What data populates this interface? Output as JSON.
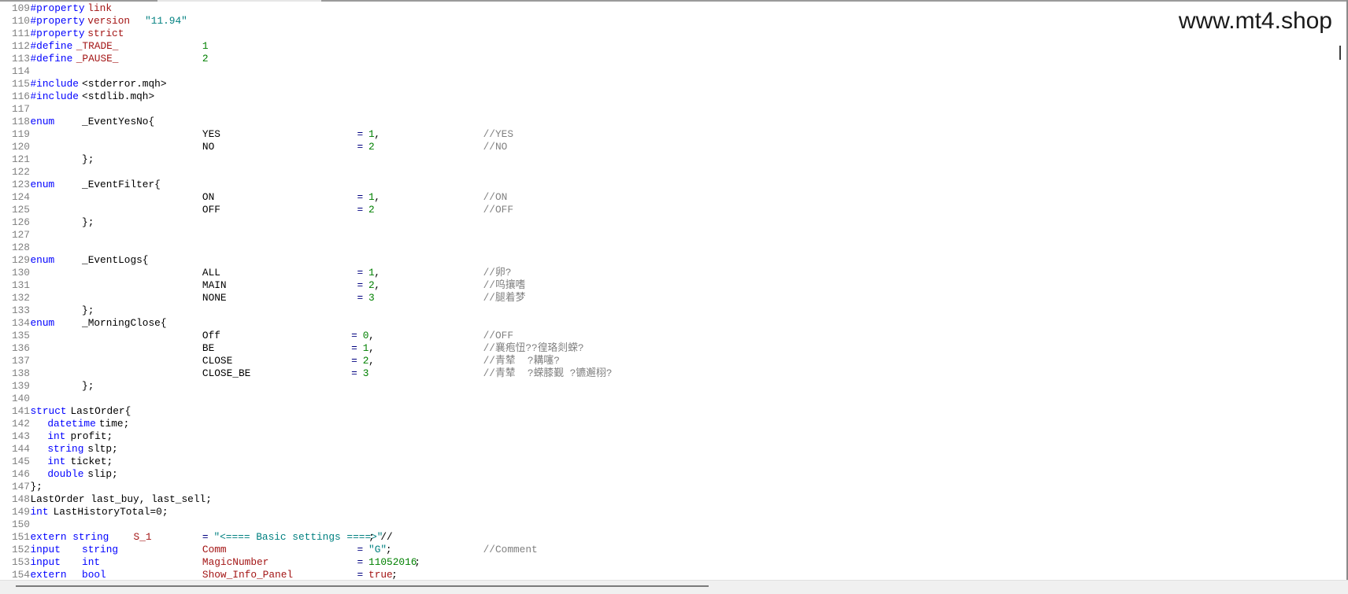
{
  "watermark": "www.mt4.shop",
  "colors": {
    "line_number": "#808080",
    "keyword": "#0000ff",
    "identifier_red": "#a31515",
    "string": "#008080",
    "number": "#008000",
    "comment": "#808080",
    "text": "#000000"
  },
  "lines": [
    {
      "num": "109",
      "tokens": [
        {
          "col": 0,
          "c": "kw",
          "t": "#property"
        },
        {
          "col": 10,
          "c": "red",
          "t": "link"
        }
      ]
    },
    {
      "num": "110",
      "tokens": [
        {
          "col": 0,
          "c": "kw",
          "t": "#property"
        },
        {
          "col": 10,
          "c": "red",
          "t": "version"
        },
        {
          "col": 20,
          "c": "str",
          "t": "\"11.94\""
        }
      ]
    },
    {
      "num": "111",
      "tokens": [
        {
          "col": 0,
          "c": "kw",
          "t": "#property"
        },
        {
          "col": 10,
          "c": "red",
          "t": "strict"
        }
      ]
    },
    {
      "num": "112",
      "tokens": [
        {
          "col": 0,
          "c": "kw",
          "t": "#define"
        },
        {
          "col": 8,
          "c": "red",
          "t": "_TRADE_"
        },
        {
          "col": 30,
          "c": "num",
          "t": "1"
        }
      ]
    },
    {
      "num": "113",
      "tokens": [
        {
          "col": 0,
          "c": "kw",
          "t": "#define"
        },
        {
          "col": 8,
          "c": "red",
          "t": "_PAUSE_"
        },
        {
          "col": 30,
          "c": "num",
          "t": "2"
        }
      ]
    },
    {
      "num": "114",
      "tokens": []
    },
    {
      "num": "115",
      "tokens": [
        {
          "col": 0,
          "c": "kw",
          "t": "#include"
        },
        {
          "col": 9,
          "c": "text",
          "t": "<stderror.mqh>"
        }
      ]
    },
    {
      "num": "116",
      "tokens": [
        {
          "col": 0,
          "c": "kw",
          "t": "#include"
        },
        {
          "col": 9,
          "c": "text",
          "t": "<stdlib.mqh>"
        }
      ]
    },
    {
      "num": "117",
      "tokens": []
    },
    {
      "num": "118",
      "tokens": [
        {
          "col": 0,
          "c": "kw",
          "t": "enum"
        },
        {
          "col": 9,
          "c": "text",
          "t": "_EventYesNo{"
        }
      ]
    },
    {
      "num": "119",
      "tokens": [
        {
          "col": 30,
          "c": "text",
          "t": "YES"
        },
        {
          "col": 57,
          "c": "op",
          "t": "="
        },
        {
          "col": 59,
          "c": "num",
          "t": "1"
        },
        {
          "col": 60,
          "c": "text",
          "t": ","
        },
        {
          "col": 79,
          "c": "cmt",
          "t": "//YES"
        }
      ]
    },
    {
      "num": "120",
      "tokens": [
        {
          "col": 30,
          "c": "text",
          "t": "NO"
        },
        {
          "col": 57,
          "c": "op",
          "t": "="
        },
        {
          "col": 59,
          "c": "num",
          "t": "2"
        },
        {
          "col": 79,
          "c": "cmt",
          "t": "//NO"
        }
      ]
    },
    {
      "num": "121",
      "tokens": [
        {
          "col": 9,
          "c": "text",
          "t": "};"
        }
      ]
    },
    {
      "num": "122",
      "tokens": []
    },
    {
      "num": "123",
      "tokens": [
        {
          "col": 0,
          "c": "kw",
          "t": "enum"
        },
        {
          "col": 9,
          "c": "text",
          "t": "_EventFilter{"
        }
      ]
    },
    {
      "num": "124",
      "tokens": [
        {
          "col": 30,
          "c": "text",
          "t": "ON"
        },
        {
          "col": 57,
          "c": "op",
          "t": "="
        },
        {
          "col": 59,
          "c": "num",
          "t": "1"
        },
        {
          "col": 60,
          "c": "text",
          "t": ","
        },
        {
          "col": 79,
          "c": "cmt",
          "t": "//ON"
        }
      ]
    },
    {
      "num": "125",
      "tokens": [
        {
          "col": 30,
          "c": "text",
          "t": "OFF"
        },
        {
          "col": 57,
          "c": "op",
          "t": "="
        },
        {
          "col": 59,
          "c": "num",
          "t": "2"
        },
        {
          "col": 79,
          "c": "cmt",
          "t": "//OFF"
        }
      ]
    },
    {
      "num": "126",
      "tokens": [
        {
          "col": 9,
          "c": "text",
          "t": "};"
        }
      ]
    },
    {
      "num": "127",
      "tokens": []
    },
    {
      "num": "128",
      "tokens": []
    },
    {
      "num": "129",
      "tokens": [
        {
          "col": 0,
          "c": "kw",
          "t": "enum"
        },
        {
          "col": 9,
          "c": "text",
          "t": "_EventLogs{"
        }
      ]
    },
    {
      "num": "130",
      "tokens": [
        {
          "col": 30,
          "c": "text",
          "t": "ALL"
        },
        {
          "col": 57,
          "c": "op",
          "t": "="
        },
        {
          "col": 59,
          "c": "num",
          "t": "1"
        },
        {
          "col": 60,
          "c": "text",
          "t": ","
        },
        {
          "col": 79,
          "c": "cmt",
          "t": "//卵?"
        }
      ]
    },
    {
      "num": "131",
      "tokens": [
        {
          "col": 30,
          "c": "text",
          "t": "MAIN"
        },
        {
          "col": 57,
          "c": "op",
          "t": "="
        },
        {
          "col": 59,
          "c": "num",
          "t": "2"
        },
        {
          "col": 60,
          "c": "text",
          "t": ","
        },
        {
          "col": 79,
          "c": "cmt",
          "t": "//呜攘嗜"
        }
      ]
    },
    {
      "num": "132",
      "tokens": [
        {
          "col": 30,
          "c": "text",
          "t": "NONE"
        },
        {
          "col": 57,
          "c": "op",
          "t": "="
        },
        {
          "col": 59,
          "c": "num",
          "t": "3"
        },
        {
          "col": 79,
          "c": "cmt",
          "t": "//腿着梦"
        }
      ]
    },
    {
      "num": "133",
      "tokens": [
        {
          "col": 9,
          "c": "text",
          "t": "};"
        }
      ]
    },
    {
      "num": "134",
      "tokens": [
        {
          "col": 0,
          "c": "kw",
          "t": "enum"
        },
        {
          "col": 9,
          "c": "text",
          "t": "_MorningClose{"
        }
      ]
    },
    {
      "num": "135",
      "tokens": [
        {
          "col": 30,
          "c": "text",
          "t": "Off"
        },
        {
          "col": 56,
          "c": "op",
          "t": "="
        },
        {
          "col": 58,
          "c": "num",
          "t": "0"
        },
        {
          "col": 59,
          "c": "text",
          "t": ","
        },
        {
          "col": 79,
          "c": "cmt",
          "t": "//OFF"
        }
      ]
    },
    {
      "num": "136",
      "tokens": [
        {
          "col": 30,
          "c": "text",
          "t": "BE"
        },
        {
          "col": 56,
          "c": "op",
          "t": "="
        },
        {
          "col": 58,
          "c": "num",
          "t": "1"
        },
        {
          "col": 59,
          "c": "text",
          "t": ","
        },
        {
          "col": 79,
          "c": "cmt",
          "t": "//襄疱忸??徨珞剡蝾?"
        }
      ]
    },
    {
      "num": "137",
      "tokens": [
        {
          "col": 30,
          "c": "text",
          "t": "CLOSE"
        },
        {
          "col": 56,
          "c": "op",
          "t": "="
        },
        {
          "col": 58,
          "c": "num",
          "t": "2"
        },
        {
          "col": 59,
          "c": "text",
          "t": ","
        },
        {
          "col": 79,
          "c": "cmt",
          "t": "//青辇  ?耩噻?"
        }
      ]
    },
    {
      "num": "138",
      "tokens": [
        {
          "col": 30,
          "c": "text",
          "t": "CLOSE_BE"
        },
        {
          "col": 56,
          "c": "op",
          "t": "="
        },
        {
          "col": 58,
          "c": "num",
          "t": "3"
        },
        {
          "col": 79,
          "c": "cmt",
          "t": "//青辇  ?蝾膝觐 ?镳邂栩?"
        }
      ]
    },
    {
      "num": "139",
      "tokens": [
        {
          "col": 9,
          "c": "text",
          "t": "};"
        }
      ]
    },
    {
      "num": "140",
      "tokens": []
    },
    {
      "num": "141",
      "tokens": [
        {
          "col": 0,
          "c": "kw",
          "t": "struct"
        },
        {
          "col": 7,
          "c": "text",
          "t": "LastOrder{"
        }
      ]
    },
    {
      "num": "142",
      "tokens": [
        {
          "col": 3,
          "c": "kw",
          "t": "datetime"
        },
        {
          "col": 12,
          "c": "text",
          "t": "time;"
        }
      ]
    },
    {
      "num": "143",
      "tokens": [
        {
          "col": 3,
          "c": "kw",
          "t": "int"
        },
        {
          "col": 7,
          "c": "text",
          "t": "profit;"
        }
      ]
    },
    {
      "num": "144",
      "tokens": [
        {
          "col": 3,
          "c": "kw",
          "t": "string"
        },
        {
          "col": 10,
          "c": "text",
          "t": "sltp;"
        }
      ]
    },
    {
      "num": "145",
      "tokens": [
        {
          "col": 3,
          "c": "kw",
          "t": "int"
        },
        {
          "col": 7,
          "c": "text",
          "t": "ticket;"
        }
      ]
    },
    {
      "num": "146",
      "tokens": [
        {
          "col": 3,
          "c": "kw",
          "t": "double"
        },
        {
          "col": 10,
          "c": "text",
          "t": "slip;"
        }
      ]
    },
    {
      "num": "147",
      "tokens": [
        {
          "col": 0,
          "c": "text",
          "t": "};"
        }
      ]
    },
    {
      "num": "148",
      "tokens": [
        {
          "col": 0,
          "c": "text",
          "t": "LastOrder last_buy, last_sell;"
        }
      ]
    },
    {
      "num": "149",
      "tokens": [
        {
          "col": 0,
          "c": "kw",
          "t": "int"
        },
        {
          "col": 4,
          "c": "text",
          "t": "LastHistoryTotal=0;"
        }
      ]
    },
    {
      "num": "150",
      "tokens": []
    },
    {
      "num": "151",
      "tokens": [
        {
          "col": 0,
          "c": "kw",
          "t": "extern string"
        },
        {
          "col": 18,
          "c": "red",
          "t": "S_1"
        },
        {
          "col": 30,
          "c": "op",
          "t": "="
        },
        {
          "col": 32,
          "c": "str",
          "t": "\"<==== Basic settings ====>\""
        },
        {
          "col": 59,
          "c": "text",
          "t": "; //"
        }
      ]
    },
    {
      "num": "152",
      "tokens": [
        {
          "col": 0,
          "c": "kw",
          "t": "input"
        },
        {
          "col": 9,
          "c": "kw",
          "t": "string"
        },
        {
          "col": 30,
          "c": "red",
          "t": "Comm"
        },
        {
          "col": 57,
          "c": "op",
          "t": "="
        },
        {
          "col": 59,
          "c": "str",
          "t": "\"G\""
        },
        {
          "col": 62,
          "c": "text",
          "t": ";"
        },
        {
          "col": 79,
          "c": "cmt",
          "t": "//Comment"
        }
      ]
    },
    {
      "num": "153",
      "tokens": [
        {
          "col": 0,
          "c": "kw",
          "t": "input"
        },
        {
          "col": 9,
          "c": "kw",
          "t": "int"
        },
        {
          "col": 30,
          "c": "red",
          "t": "MagicNumber"
        },
        {
          "col": 57,
          "c": "op",
          "t": "="
        },
        {
          "col": 59,
          "c": "num",
          "t": "11052016"
        },
        {
          "col": 67,
          "c": "text",
          "t": ";"
        }
      ]
    },
    {
      "num": "154",
      "tokens": [
        {
          "col": 0,
          "c": "kw",
          "t": "extern"
        },
        {
          "col": 9,
          "c": "kw",
          "t": "bool"
        },
        {
          "col": 30,
          "c": "red",
          "t": "Show_Info_Panel"
        },
        {
          "col": 57,
          "c": "op",
          "t": "="
        },
        {
          "col": 59,
          "c": "red",
          "t": "true"
        },
        {
          "col": 63,
          "c": "text",
          "t": ";"
        }
      ]
    }
  ]
}
